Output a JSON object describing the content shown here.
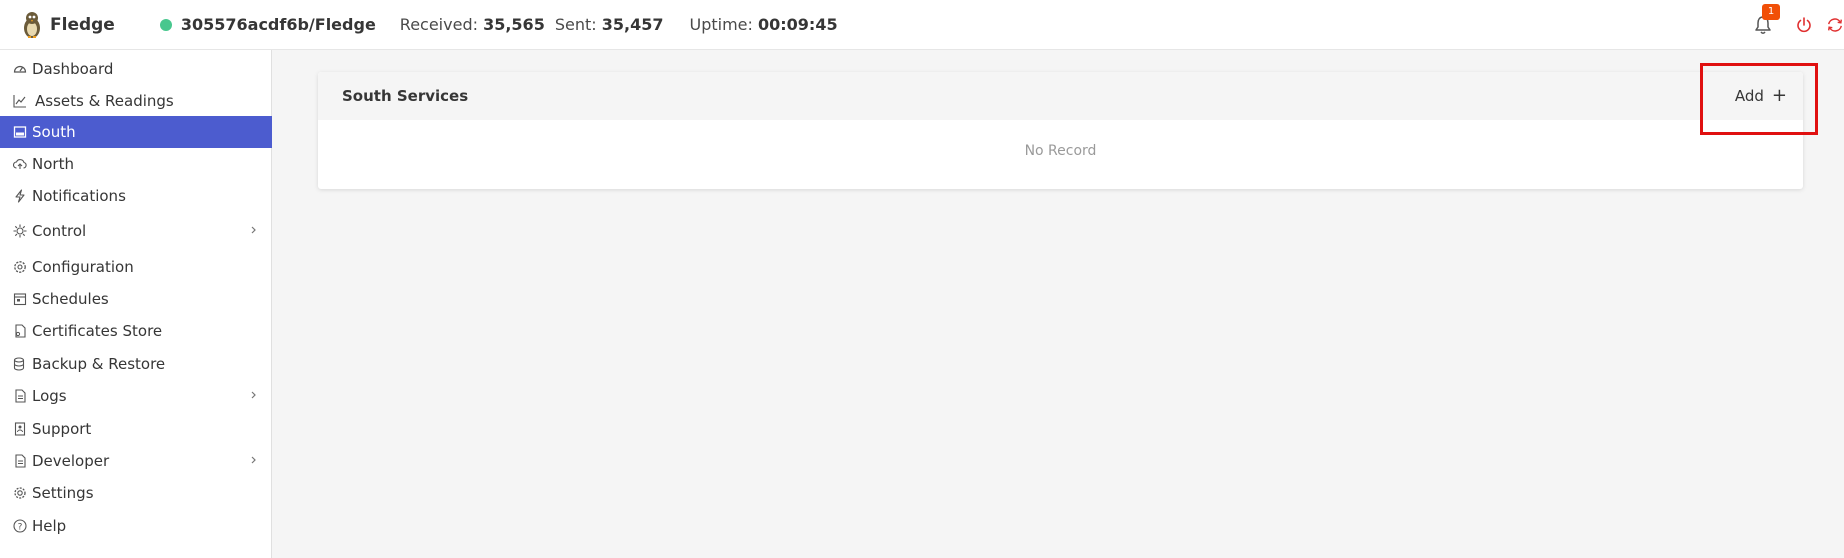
{
  "navbar": {
    "brand": "Fledge",
    "instance": "305576acdf6b/Fledge",
    "status_color": "#48c78e",
    "received_label": "Received:",
    "received_value": "35,565",
    "sent_label": "Sent:",
    "sent_value": "35,457",
    "uptime_label": "Uptime:",
    "uptime_value": "00:09:45",
    "notification_count": "1",
    "icons": [
      "bell-icon",
      "power-icon",
      "refresh-icon"
    ]
  },
  "sidebar": {
    "items": [
      {
        "label": "Dashboard",
        "icon": "dashboard-icon"
      },
      {
        "label": "Assets & Readings",
        "icon": "chart-icon"
      },
      {
        "label": "South",
        "icon": "south-icon",
        "active": true
      },
      {
        "label": "North",
        "icon": "cloud-upload-icon"
      },
      {
        "label": "Notifications",
        "icon": "bolt-icon"
      },
      {
        "label": "Control",
        "icon": "control-icon",
        "expandable": true
      },
      {
        "label": "Configuration",
        "icon": "gear-icon"
      },
      {
        "label": "Schedules",
        "icon": "calendar-icon"
      },
      {
        "label": "Certificates Store",
        "icon": "certificate-icon"
      },
      {
        "label": "Backup & Restore",
        "icon": "database-icon"
      },
      {
        "label": "Logs",
        "icon": "file-icon",
        "expandable": true
      },
      {
        "label": "Support",
        "icon": "support-icon"
      },
      {
        "label": "Developer",
        "icon": "file-code-icon",
        "expandable": true
      },
      {
        "label": "Settings",
        "icon": "settings-icon"
      },
      {
        "label": "Help",
        "icon": "help-icon"
      }
    ],
    "active_color": "#4c5ccf"
  },
  "main": {
    "card_title": "South Services",
    "add_label": "Add",
    "add_symbol": "+",
    "empty_text": "No Record"
  },
  "colors": {
    "highlight": "#e01010",
    "badge": "#f14f07"
  }
}
